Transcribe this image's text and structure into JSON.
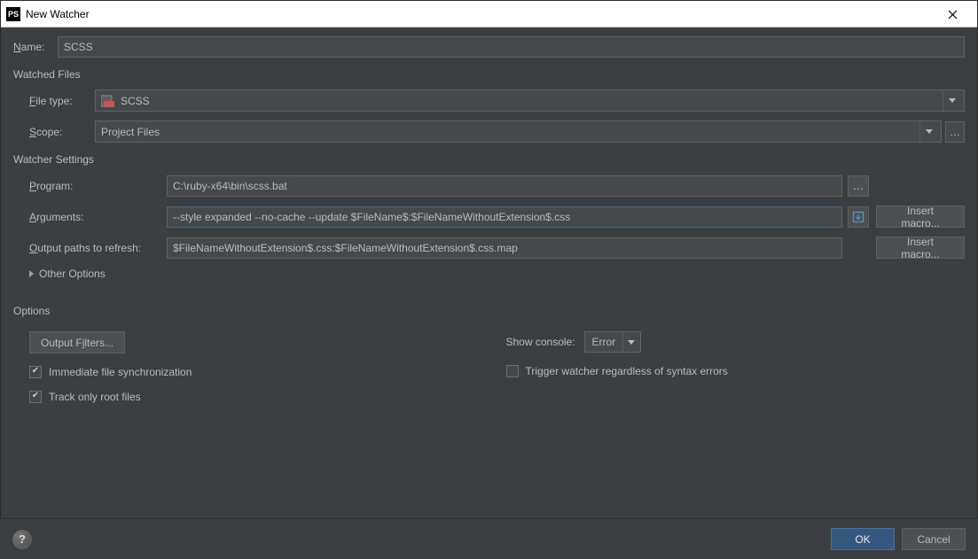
{
  "window": {
    "title": "New Watcher",
    "app_badge": "PS"
  },
  "name_field": {
    "label": "Name:",
    "label_u": "N",
    "value": "SCSS"
  },
  "watched_files": {
    "section": "Watched Files",
    "file_type": {
      "label": "File type:",
      "label_u": "F",
      "value": "SCSS"
    },
    "scope": {
      "label": "Scope:",
      "label_u": "S",
      "value": "Project Files"
    }
  },
  "watcher_settings": {
    "section": "Watcher Settings",
    "program": {
      "label": "Program:",
      "label_u": "P",
      "value": "C:\\ruby-x64\\bin\\scss.bat"
    },
    "arguments": {
      "label": "Arguments:",
      "label_u": "A",
      "value": "--style expanded --no-cache --update $FileName$:$FileNameWithoutExtension$.css"
    },
    "output_paths": {
      "label": "Output paths to refresh:",
      "label_u": "O",
      "value": "$FileNameWithoutExtension$.css:$FileNameWithoutExtension$.css.map"
    },
    "other_options": "Other Options",
    "insert_macro": "Insert macro..."
  },
  "options": {
    "section": "Options",
    "output_filters": "Output Filters...",
    "output_filters_u": "i",
    "immediate_sync": "Immediate file synchronization",
    "track_root": "Track only root files",
    "show_console_label": "Show console:",
    "show_console_value": "Error",
    "trigger_regardless": "Trigger watcher regardless of syntax errors"
  },
  "footer": {
    "ok": "OK",
    "cancel": "Cancel"
  }
}
